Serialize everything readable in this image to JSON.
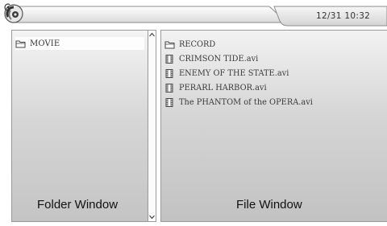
{
  "status_bar": {
    "datetime": "12/31 10:32"
  },
  "folder_window": {
    "caption": "Folder Window",
    "items": [
      {
        "label": "MOVIE",
        "icon": "folder-icon",
        "selected": true
      }
    ]
  },
  "file_window": {
    "caption": "File Window",
    "items": [
      {
        "label": "RECORD",
        "icon": "folder-icon"
      },
      {
        "label": "CRIMSON TIDE.avi",
        "icon": "film-icon"
      },
      {
        "label": "ENEMY OF THE STATE.avi",
        "icon": "film-icon"
      },
      {
        "label": "PERARL HARBOR.avi",
        "icon": "film-icon"
      },
      {
        "label": "The PHANTOM of the OPERA.avi",
        "icon": "film-icon"
      }
    ]
  },
  "colors": {
    "panel_top": "#f4f4f4",
    "panel_bottom": "#c4c4c4",
    "border": "#9a9a9a",
    "text": "#333333"
  }
}
